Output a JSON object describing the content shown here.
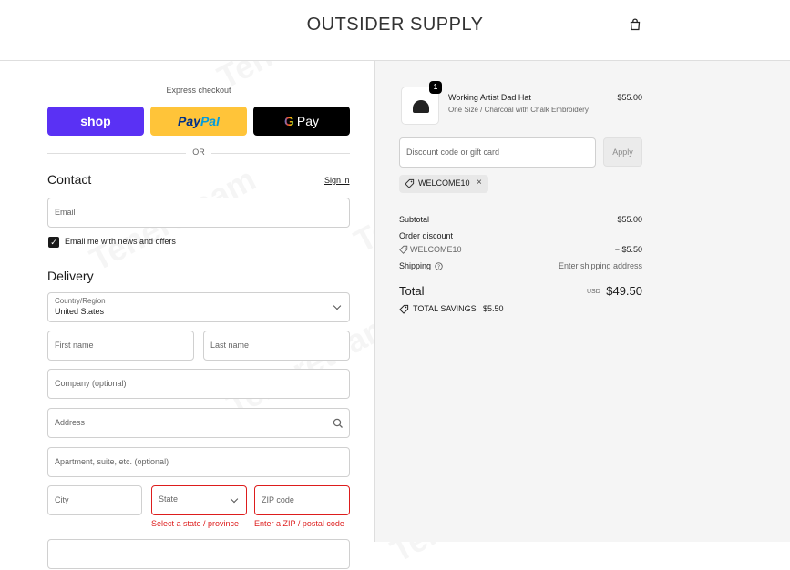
{
  "header": {
    "store_name": "OUTSIDER SUPPLY",
    "cart_icon": "shopping-bag-icon"
  },
  "express": {
    "label": "Express checkout",
    "shop_label": "shop",
    "paypal_label_1": "Pay",
    "paypal_label_2": "Pal",
    "gpay_g": "G",
    "gpay_label": "Pay",
    "or_label": "OR"
  },
  "contact": {
    "heading": "Contact",
    "sign_in": "Sign in",
    "email_placeholder": "Email",
    "newsletter_label": "Email me with news and offers",
    "newsletter_checked": true
  },
  "delivery": {
    "heading": "Delivery",
    "country_label": "Country/Region",
    "country_value": "United States",
    "first_name": "First name",
    "last_name": "Last name",
    "company": "Company (optional)",
    "address": "Address",
    "apartment": "Apartment, suite, etc. (optional)",
    "city": "City",
    "state": "State",
    "zip": "ZIP code",
    "state_error": "Select a state / province",
    "zip_error": "Enter a ZIP / postal code"
  },
  "summary": {
    "item": {
      "name": "Working Artist Dad Hat",
      "variant": "One Size / Charcoal with Chalk Embroidery",
      "price": "$55.00",
      "quantity": "1"
    },
    "discount_placeholder": "Discount code or gift card",
    "apply_label": "Apply",
    "applied_code": "WELCOME10",
    "subtotal_label": "Subtotal",
    "subtotal_value": "$55.00",
    "order_discount_label": "Order discount",
    "discount_code": "WELCOME10",
    "discount_value": "− $5.50",
    "shipping_label": "Shipping",
    "shipping_value": "Enter shipping address",
    "total_label": "Total",
    "currency": "USD",
    "total_value": "$49.50",
    "savings_label": "TOTAL SAVINGS",
    "savings_value": "$5.50"
  },
  "colors": {
    "shop": "#5a31f4",
    "paypal": "#ffc439",
    "error": "#dd1d1d"
  }
}
